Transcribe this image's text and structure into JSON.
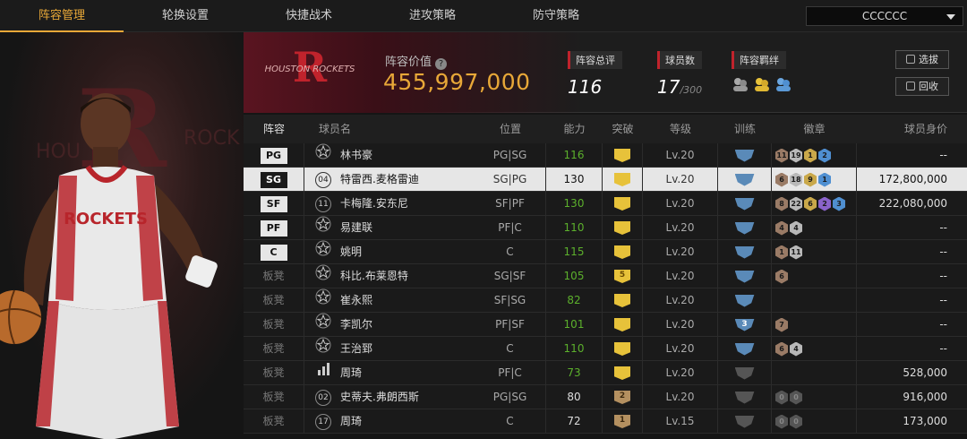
{
  "tabs": [
    {
      "label": "阵容管理",
      "active": true
    },
    {
      "label": "轮换设置",
      "active": false
    },
    {
      "label": "快捷战术",
      "active": false
    },
    {
      "label": "进攻策略",
      "active": false
    },
    {
      "label": "防守策略",
      "active": false
    }
  ],
  "dropdown": {
    "value": "CCCCCC"
  },
  "team": {
    "logo_text": "HOUSTON ROCKETS",
    "jersey_text": "ROCKETS"
  },
  "header": {
    "value_label": "阵容价值",
    "value": "455,997,000",
    "overall": {
      "label": "阵容总评",
      "value": "116"
    },
    "players": {
      "label": "球员数",
      "value": "17",
      "max": "/300"
    },
    "bond": {
      "label": "阵容羁绊"
    },
    "btn_pick": "选拔",
    "btn_recycle": "回收"
  },
  "columns": {
    "pos": "阵容",
    "name": "球员名",
    "position": "位置",
    "ability": "能力",
    "breakthrough": "突破",
    "level": "等级",
    "training": "训练",
    "badges": "徽章",
    "price": "球员身价"
  },
  "colors": {
    "accent": "#e8a838",
    "red": "#c0232c",
    "green": "#5cb02c",
    "hex_bronze": "#9a7b66",
    "hex_silver": "#b8b8b8",
    "hex_gold": "#c9a84a",
    "hex_purple": "#8a63c9",
    "hex_blue": "#4f8fd1"
  },
  "rows": [
    {
      "slot": "PG",
      "starter": true,
      "num_icon": "star",
      "name": "林书豪",
      "position": "PG|SG",
      "ability": "116",
      "green": true,
      "break": "",
      "break_style": "gold",
      "level": "Lv.20",
      "train": "",
      "train_style": "blue",
      "badges": [
        [
          "11",
          "bronze"
        ],
        [
          "19",
          "silver"
        ],
        [
          "1",
          "gold"
        ],
        [
          "2",
          "blue"
        ]
      ],
      "price": "--",
      "selected": false
    },
    {
      "slot": "SG",
      "starter": true,
      "num_icon": "04",
      "name": "特雷西.麦格雷迪",
      "position": "SG|PG",
      "ability": "130",
      "green": false,
      "break": "",
      "break_style": "gold",
      "level": "Lv.20",
      "train": "",
      "train_style": "blue",
      "badges": [
        [
          "6",
          "bronze"
        ],
        [
          "18",
          "silver"
        ],
        [
          "9",
          "gold"
        ],
        [
          "1",
          "blue"
        ]
      ],
      "price": "172,800,000",
      "selected": true
    },
    {
      "slot": "SF",
      "starter": true,
      "num_icon": "11",
      "name": "卡梅隆.安东尼",
      "position": "SF|PF",
      "ability": "130",
      "green": true,
      "break": "",
      "break_style": "gold",
      "level": "Lv.20",
      "train": "",
      "train_style": "blue",
      "badges": [
        [
          "8",
          "bronze"
        ],
        [
          "22",
          "silver"
        ],
        [
          "6",
          "gold"
        ],
        [
          "2",
          "purple"
        ],
        [
          "3",
          "blue"
        ]
      ],
      "price": "222,080,000",
      "selected": false
    },
    {
      "slot": "PF",
      "starter": true,
      "num_icon": "star",
      "name": "易建联",
      "position": "PF|C",
      "ability": "110",
      "green": true,
      "break": "",
      "break_style": "gold",
      "level": "Lv.20",
      "train": "",
      "train_style": "blue",
      "badges": [
        [
          "4",
          "bronze"
        ],
        [
          "4",
          "silver"
        ]
      ],
      "price": "--",
      "selected": false
    },
    {
      "slot": "C",
      "starter": true,
      "num_icon": "star",
      "name": "姚明",
      "position": "C",
      "ability": "115",
      "green": true,
      "break": "",
      "break_style": "gold",
      "level": "Lv.20",
      "train": "",
      "train_style": "blue",
      "badges": [
        [
          "1",
          "bronze"
        ],
        [
          "11",
          "silver"
        ]
      ],
      "price": "--",
      "selected": false
    },
    {
      "slot": "板凳",
      "starter": false,
      "num_icon": "star",
      "name": "科比.布莱恩特",
      "position": "SG|SF",
      "ability": "105",
      "green": true,
      "break": "5",
      "break_style": "gold",
      "level": "Lv.20",
      "train": "",
      "train_style": "blue",
      "badges": [
        [
          "6",
          "bronze"
        ]
      ],
      "price": "--",
      "selected": false
    },
    {
      "slot": "板凳",
      "starter": false,
      "num_icon": "star",
      "name": "崔永熙",
      "position": "SF|SG",
      "ability": "82",
      "green": true,
      "break": "",
      "break_style": "gold",
      "level": "Lv.20",
      "train": "",
      "train_style": "blue",
      "badges": [],
      "price": "--",
      "selected": false
    },
    {
      "slot": "板凳",
      "starter": false,
      "num_icon": "star",
      "name": "李凯尔",
      "position": "PF|SF",
      "ability": "101",
      "green": true,
      "break": "",
      "break_style": "gold",
      "level": "Lv.20",
      "train": "3",
      "train_style": "blue",
      "badges": [
        [
          "7",
          "bronze"
        ]
      ],
      "price": "--",
      "selected": false
    },
    {
      "slot": "板凳",
      "starter": false,
      "num_icon": "star",
      "name": "王治郅",
      "position": "C",
      "ability": "110",
      "green": true,
      "break": "",
      "break_style": "gold",
      "level": "Lv.20",
      "train": "",
      "train_style": "blue",
      "badges": [
        [
          "6",
          "bronze"
        ],
        [
          "4",
          "silver"
        ]
      ],
      "price": "--",
      "selected": false
    },
    {
      "slot": "板凳",
      "starter": false,
      "num_icon": "bars",
      "name": "周琦",
      "position": "PF|C",
      "ability": "73",
      "green": true,
      "break": "",
      "break_style": "gold",
      "level": "Lv.20",
      "train": "",
      "train_style": "grey",
      "badges": [],
      "price": "528,000",
      "selected": false
    },
    {
      "slot": "板凳",
      "starter": false,
      "num_icon": "02",
      "name": "史蒂夫.弗朗西斯",
      "position": "PG|SG",
      "ability": "80",
      "green": false,
      "break": "2",
      "break_style": "tan",
      "level": "Lv.20",
      "train": "",
      "train_style": "grey",
      "badges": [
        [
          "0",
          "grey"
        ],
        [
          "0",
          "grey"
        ]
      ],
      "price": "916,000",
      "selected": false
    },
    {
      "slot": "板凳",
      "starter": false,
      "num_icon": "17",
      "name": "周琦",
      "position": "C",
      "ability": "72",
      "green": false,
      "break": "1",
      "break_style": "tan",
      "level": "Lv.15",
      "train": "",
      "train_style": "grey",
      "badges": [
        [
          "0",
          "grey"
        ],
        [
          "0",
          "grey"
        ]
      ],
      "price": "173,000",
      "selected": false
    }
  ]
}
